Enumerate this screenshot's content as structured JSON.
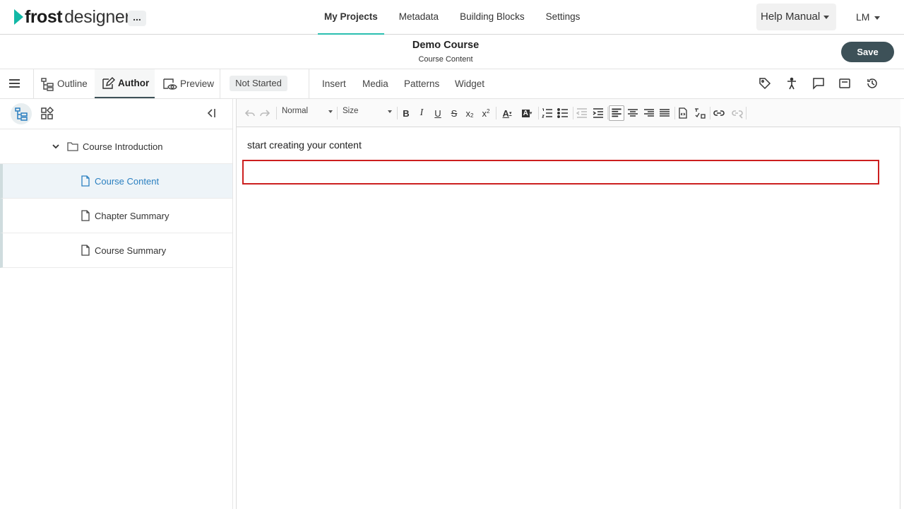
{
  "app": {
    "logo_bold": "frost",
    "logo_light": "designer",
    "more_label": "..."
  },
  "nav": {
    "items": [
      {
        "label": "My Projects",
        "active": true
      },
      {
        "label": "Metadata"
      },
      {
        "label": "Building Blocks"
      },
      {
        "label": "Settings"
      }
    ],
    "help_label": "Help Manual",
    "user_initials": "LM"
  },
  "course": {
    "title": "Demo Course",
    "subtitle": "Course Content",
    "save_label": "Save"
  },
  "modes": {
    "tabs": [
      {
        "label": "Outline"
      },
      {
        "label": "Author",
        "active": true
      },
      {
        "label": "Preview"
      }
    ],
    "status": "Not Started",
    "menu": [
      "Insert",
      "Media",
      "Patterns",
      "Widget"
    ]
  },
  "tree": {
    "parent": "Course Introduction",
    "children": [
      "Course Content",
      "Chapter Summary",
      "Course Summary"
    ],
    "selected": "Course Content"
  },
  "editor": {
    "format_select": "Normal",
    "size_select": "Size",
    "content_text": "start creating your content"
  },
  "colors": {
    "accent": "#2bbfb0",
    "logo": "#12b8a6",
    "save_bg": "#3d5158",
    "selected_text": "#2a7fc0",
    "highlight": "#cc1f1f"
  }
}
